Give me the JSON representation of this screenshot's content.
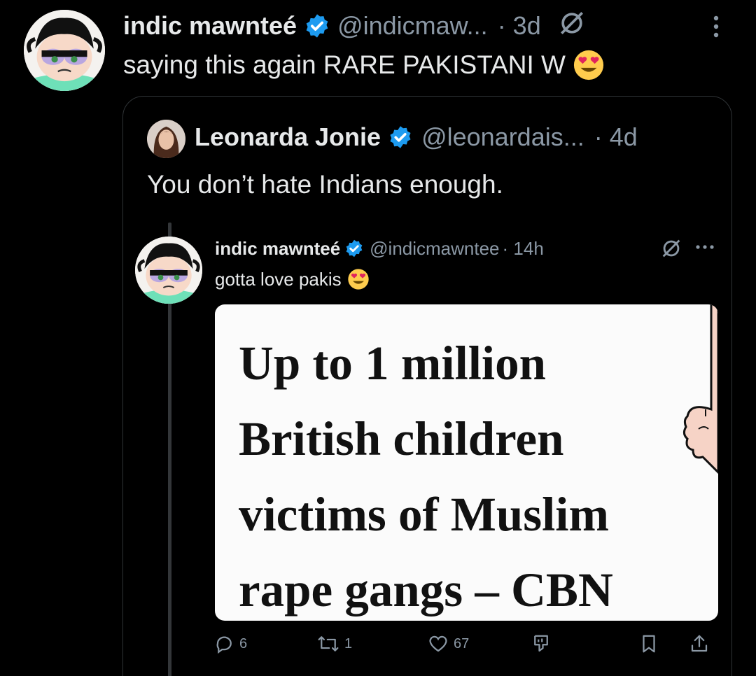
{
  "outer_tweet": {
    "display_name": "indic mawnteé",
    "handle": "@indicmaw...",
    "time": "· 3d",
    "text": "saying this again RARE PAKISTANI W",
    "emoji": "heart-eyes-emoji"
  },
  "quoted_tweet": {
    "display_name": "Leonarda Jonie",
    "handle": "@leonardais...",
    "time": "· 4d",
    "text": "You don’t hate Indians enough."
  },
  "reply_tweet": {
    "display_name": "indic mawnteé",
    "handle": "@indicmawntee",
    "time": "· 14h",
    "text": "gotta love pakis",
    "image_headline": [
      "Up to 1 million",
      "British children",
      "victims of Muslim",
      "rape gangs – CBN"
    ]
  },
  "actions": {
    "replies": "6",
    "reposts": "1",
    "likes": "67"
  },
  "colors": {
    "background": "#000000",
    "verified": "#1d9bf0",
    "secondary_text": "#8b98a5",
    "border": "#2f3336"
  }
}
